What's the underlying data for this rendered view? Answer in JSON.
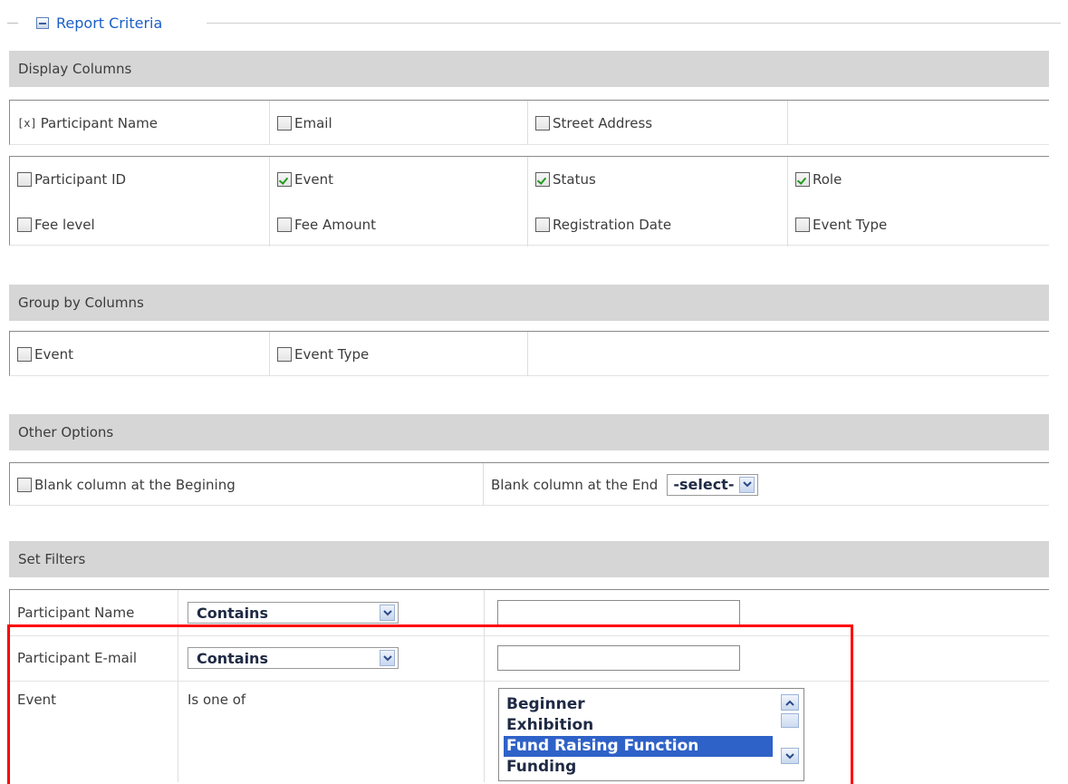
{
  "fieldset": {
    "legend": "Report Criteria"
  },
  "display_columns": {
    "header": "Display Columns",
    "required_flag": "[x]",
    "required_label": "Participant Name",
    "row1": [
      {
        "label": "Email",
        "checked": false
      },
      {
        "label": "Street Address",
        "checked": false
      }
    ],
    "row2": [
      {
        "label": "Participant ID",
        "checked": false
      },
      {
        "label": "Event",
        "checked": true
      },
      {
        "label": "Status",
        "checked": true
      },
      {
        "label": "Role",
        "checked": true
      }
    ],
    "row3": [
      {
        "label": "Fee level",
        "checked": false
      },
      {
        "label": "Fee Amount",
        "checked": false
      },
      {
        "label": "Registration Date",
        "checked": false
      },
      {
        "label": "Event Type",
        "checked": false
      }
    ]
  },
  "group_by": {
    "header": "Group by Columns",
    "items": [
      {
        "label": "Event",
        "checked": false
      },
      {
        "label": "Event Type",
        "checked": false
      }
    ]
  },
  "other_options": {
    "header": "Other Options",
    "blank_begin_label": "Blank column at the Begining",
    "blank_end_label": "Blank column at the End",
    "blank_end_value": "-select-"
  },
  "filters": {
    "header": "Set Filters",
    "participant_name_label": "Participant Name",
    "participant_name_op": "Contains",
    "participant_name_value": "",
    "participant_email_label": "Participant E-mail",
    "participant_email_op": "Contains",
    "participant_email_value": "",
    "event_label": "Event",
    "event_op": "Is one of",
    "event_options": [
      {
        "label": "Beginner",
        "selected": false
      },
      {
        "label": "Exhibition",
        "selected": false
      },
      {
        "label": "Fund Raising Function",
        "selected": true
      },
      {
        "label": "Funding",
        "selected": false
      }
    ]
  },
  "colors": {
    "legend_text": "#1a5fc8",
    "section_header_bg": "#d6d6d6",
    "checkmark": "#1f9b1f",
    "selected_option_bg": "#2f62c8",
    "highlight_box": "#ff0000"
  },
  "icons": {
    "legend": "collapse-icon",
    "dropdown": "chevron-down-icon",
    "scroll_up": "chevron-up-icon",
    "scroll_down": "chevron-down-icon"
  }
}
